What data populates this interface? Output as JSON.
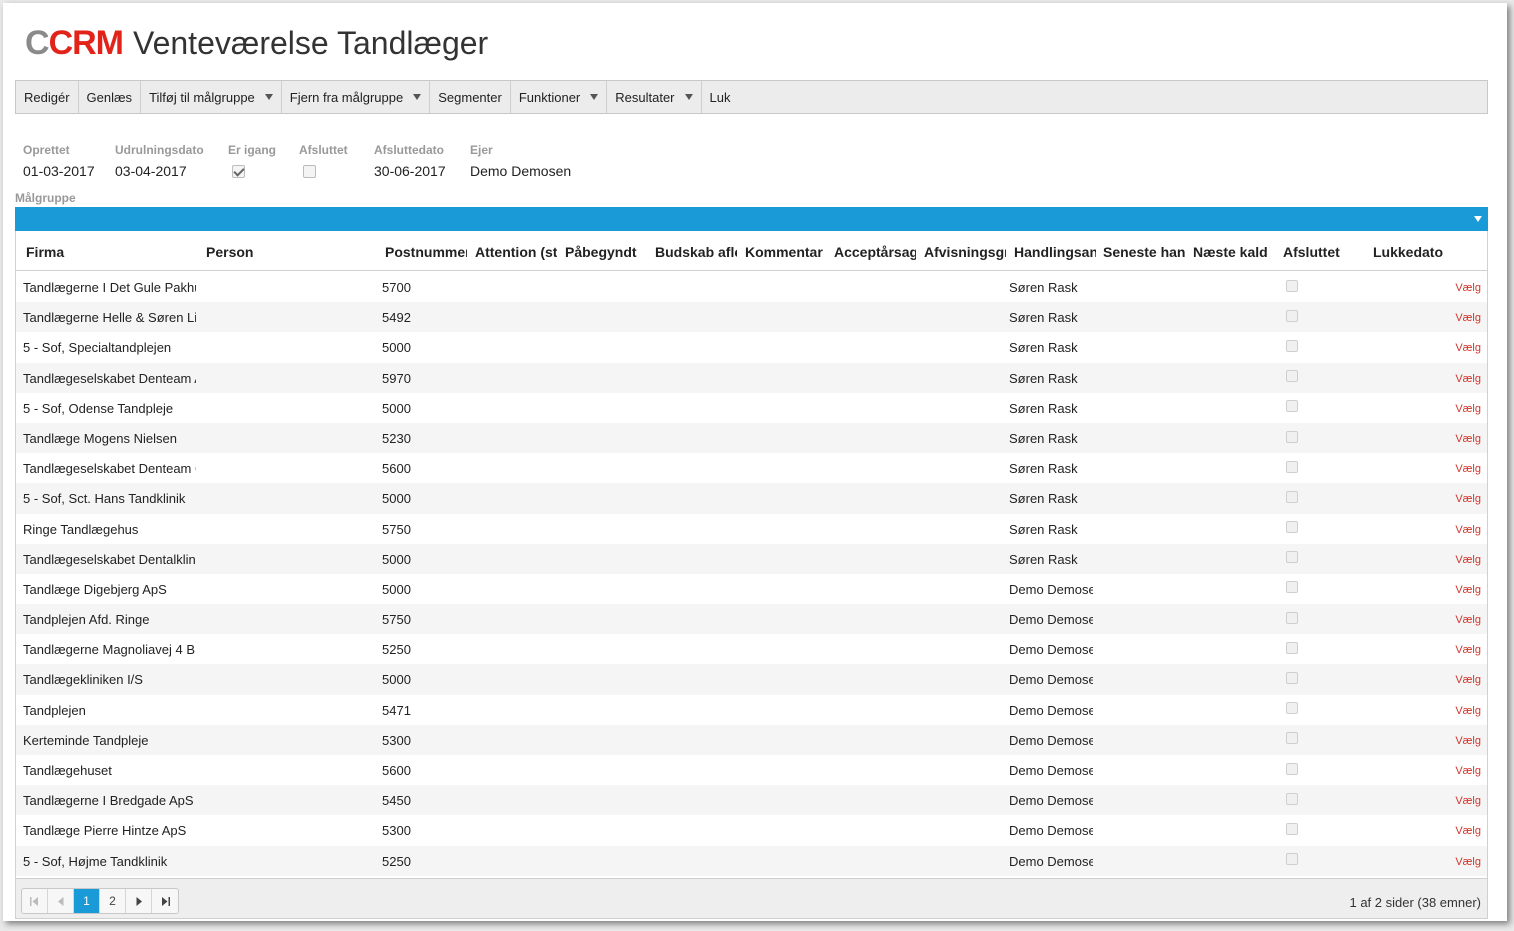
{
  "app": {
    "logo_c": "C",
    "logo_crm": "CRM",
    "title": "Venteværelse Tandlæger"
  },
  "toolbar": [
    {
      "label": "Redigér",
      "dropdown": false
    },
    {
      "label": "Genlæs",
      "dropdown": false
    },
    {
      "label": "Tilføj til målgruppe",
      "dropdown": true
    },
    {
      "label": "Fjern fra målgruppe",
      "dropdown": true
    },
    {
      "label": "Segmenter",
      "dropdown": false
    },
    {
      "label": "Funktioner",
      "dropdown": true
    },
    {
      "label": "Resultater",
      "dropdown": true
    },
    {
      "label": "Luk",
      "dropdown": false
    }
  ],
  "fields": {
    "created": {
      "label": "Oprettet",
      "value": "01-03-2017"
    },
    "rollout": {
      "label": "Udrulningsdato",
      "value": "03-04-2017"
    },
    "in_progress": {
      "label": "Er igang",
      "checked": true
    },
    "finished": {
      "label": "Afsluttet",
      "checked": false
    },
    "finished_date": {
      "label": "Afsluttedato",
      "value": "30-06-2017"
    },
    "owner": {
      "label": "Ejer",
      "value": "Demo Demosen"
    }
  },
  "group_label": "Målgruppe",
  "grid": {
    "columns": [
      "Firma",
      "Person",
      "Postnummer",
      "Attention (st",
      "Påbegyndt",
      "Budskab afle",
      "Kommentar",
      "Acceptårsag",
      "Afvisningsgr",
      "Handlingsan",
      "Seneste hand",
      "Næste kald",
      "Afsluttet",
      "Lukkedato"
    ],
    "action_label": "Vælg",
    "rows": [
      {
        "firma": "Tandlægerne I Det Gule Pakhus",
        "postnr": "5700",
        "handler": "Søren Rask"
      },
      {
        "firma": "Tandlægerne Helle & Søren Lind",
        "postnr": "5492",
        "handler": "Søren Rask"
      },
      {
        "firma": "5 - Sof, Specialtandplejen",
        "postnr": "5000",
        "handler": "Søren Rask"
      },
      {
        "firma": "Tandlægeselskabet Denteam Assens",
        "postnr": "5970",
        "handler": "Søren Rask"
      },
      {
        "firma": "5 - Sof, Odense Tandpleje",
        "postnr": "5000",
        "handler": "Søren Rask"
      },
      {
        "firma": "Tandlæge Mogens Nielsen",
        "postnr": "5230",
        "handler": "Søren Rask"
      },
      {
        "firma": "Tandlægeselskabet Denteam Ga",
        "postnr": "5600",
        "handler": "Søren Rask"
      },
      {
        "firma": "5 - Sof, Sct. Hans Tandklinik",
        "postnr": "5000",
        "handler": "Søren Rask"
      },
      {
        "firma": "Ringe Tandlægehus",
        "postnr": "5750",
        "handler": "Søren Rask"
      },
      {
        "firma": "Tandlægeselskabet Dentalklinik",
        "postnr": "5000",
        "handler": "Søren Rask"
      },
      {
        "firma": "Tandlæge Digebjerg ApS",
        "postnr": "5000",
        "handler": "Demo Demosen"
      },
      {
        "firma": "Tandplejen Afd. Ringe",
        "postnr": "5750",
        "handler": "Demo Demosen"
      },
      {
        "firma": "Tandlægerne Magnoliavej 4 B",
        "postnr": "5250",
        "handler": "Demo Demosen"
      },
      {
        "firma": "Tandlægekliniken I/S",
        "postnr": "5000",
        "handler": "Demo Demosen"
      },
      {
        "firma": "Tandplejen",
        "postnr": "5471",
        "handler": "Demo Demosen"
      },
      {
        "firma": "Kerteminde Tandpleje",
        "postnr": "5300",
        "handler": "Demo Demosen"
      },
      {
        "firma": "Tandlægehuset",
        "postnr": "5600",
        "handler": "Demo Demosen"
      },
      {
        "firma": "Tandlægerne I Bredgade ApS",
        "postnr": "5450",
        "handler": "Demo Demosen"
      },
      {
        "firma": "Tandlæge Pierre Hintze ApS",
        "postnr": "5300",
        "handler": "Demo Demosen"
      },
      {
        "firma": "5 - Sof, Højme Tandklinik",
        "postnr": "5250",
        "handler": "Demo Demosen"
      }
    ]
  },
  "pager": {
    "pages": [
      "1",
      "2"
    ],
    "active_page": "1",
    "info": "1 af 2 sider (38 emner)",
    "first_icon": "first-page-icon",
    "prev_icon": "prev-page-icon",
    "next_icon": "next-page-icon",
    "last_icon": "last-page-icon"
  },
  "colors": {
    "accent": "#1a9ad6",
    "brand_red": "#e2231a",
    "link": "#d0362c"
  }
}
